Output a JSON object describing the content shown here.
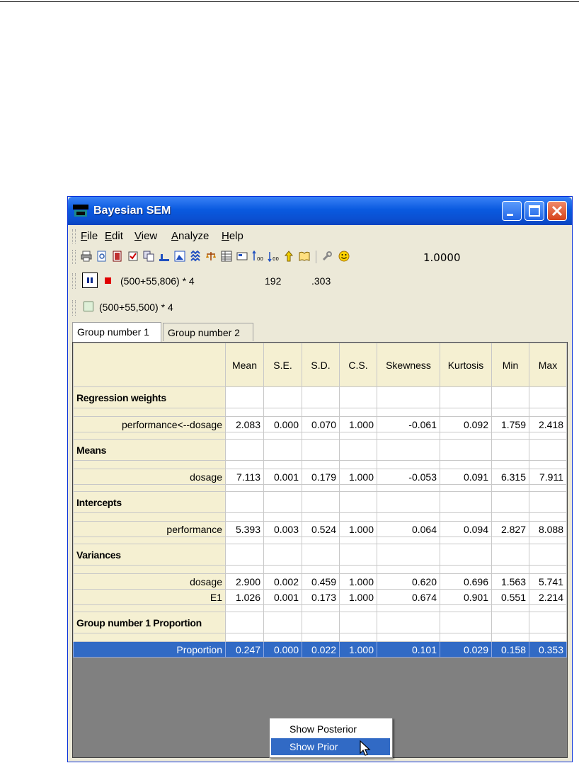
{
  "window": {
    "title": "Bayesian SEM"
  },
  "menu": {
    "items": [
      "File",
      "Edit",
      "View",
      "Analyze",
      "Help"
    ],
    "mnemonics": [
      "F",
      "E",
      "V",
      "A",
      "H"
    ]
  },
  "toolbar": {
    "icons": [
      "print-icon",
      "print-preview-icon",
      "copy-page-icon",
      "checklist-icon",
      "duplicate-icon",
      "bar-chart-icon",
      "image-icon",
      "tree-icon",
      "balance-icon",
      "table-icon",
      "options-icon",
      "increase-decimals-icon",
      "decrease-decimals-icon",
      "pointer-icon",
      "help-book-icon",
      "wrench-icon",
      "smiley-icon"
    ],
    "zoom_value": "1.0000"
  },
  "sampling": {
    "progress_expr": "(500+55,806) * 4",
    "count": "192",
    "ratio": ".303",
    "refresh_expr": "(500+55,500) * 4"
  },
  "tabs": [
    "Group number 1",
    "Group number 2"
  ],
  "table": {
    "columns": [
      "Mean",
      "S.E.",
      "S.D.",
      "C.S.",
      "Skewness",
      "Kurtosis",
      "Min",
      "Max"
    ],
    "sections": {
      "regression": "Regression weights",
      "means": "Means",
      "intercepts": "Intercepts",
      "variances": "Variances",
      "proportion": "Group number 1 Proportion"
    },
    "rows": {
      "performance_dosage": {
        "label": "performance<--dosage",
        "values": [
          "2.083",
          "0.000",
          "0.070",
          "1.000",
          "-0.061",
          "0.092",
          "1.759",
          "2.418"
        ]
      },
      "dosage_mean": {
        "label": "dosage",
        "values": [
          "7.113",
          "0.001",
          "0.179",
          "1.000",
          "-0.053",
          "0.091",
          "6.315",
          "7.911"
        ]
      },
      "performance_intercept": {
        "label": "performance",
        "values": [
          "5.393",
          "0.003",
          "0.524",
          "1.000",
          "0.064",
          "0.094",
          "2.827",
          "8.088"
        ]
      },
      "dosage_var": {
        "label": "dosage",
        "values": [
          "2.900",
          "0.002",
          "0.459",
          "1.000",
          "0.620",
          "0.696",
          "1.563",
          "5.741"
        ]
      },
      "e1_var": {
        "label": "E1",
        "values": [
          "1.026",
          "0.001",
          "0.173",
          "1.000",
          "0.674",
          "0.901",
          "0.551",
          "2.214"
        ]
      },
      "proportion": {
        "label": "Proportion",
        "values": [
          "0.247",
          "0.000",
          "0.022",
          "1.000",
          "0.101",
          "0.029",
          "0.158",
          "0.353"
        ]
      }
    }
  },
  "context_menu": {
    "items": [
      "Show Posterior",
      "Show Prior"
    ],
    "highlighted": "Show Prior"
  }
}
